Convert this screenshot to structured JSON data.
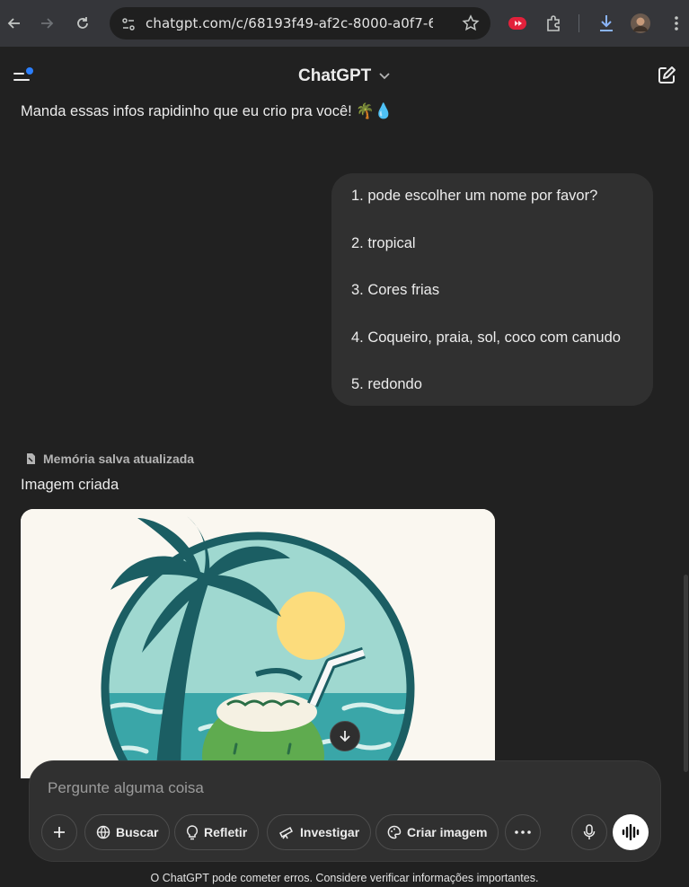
{
  "browser": {
    "url": "chatgpt.com/c/68193f49-af2c-8000-a0f7-69e6e..."
  },
  "header": {
    "title": "ChatGPT"
  },
  "conversation": {
    "assistant_intro": "Manda essas infos rapidinho que eu crio pra você! 🌴💧",
    "user_message": [
      "1. pode escolher um nome por favor?",
      "2. tropical",
      "3. Cores frias",
      "4. Coqueiro, praia, sol, coco com canudo",
      "5. redondo"
    ],
    "memory_notice": "Memória salva atualizada",
    "image_label": "Imagem criada"
  },
  "composer": {
    "placeholder": "Pergunte alguma coisa",
    "tools": {
      "search": "Buscar",
      "think": "Refletir",
      "research": "Investigar",
      "image": "Criar imagem"
    }
  },
  "footer": {
    "disclaimer": "O ChatGPT pode cometer erros. Considere verificar informações importantes."
  },
  "colors": {
    "background": "#212121",
    "bubble": "#303030",
    "teal_dark": "#1b5e63",
    "sea": "#3aa6a8",
    "sun": "#fcdc7c",
    "accent_dot": "#2b7fff"
  }
}
